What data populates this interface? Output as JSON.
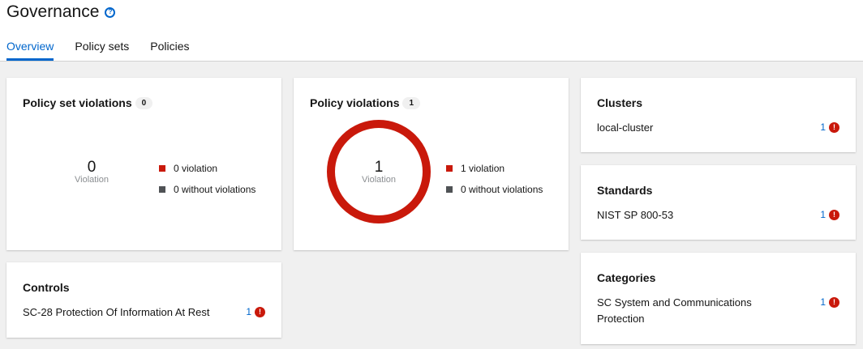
{
  "header": {
    "title": "Governance",
    "help_icon": "question-circle-icon",
    "tabs": [
      {
        "label": "Overview",
        "active": true
      },
      {
        "label": "Policy sets",
        "active": false
      },
      {
        "label": "Policies",
        "active": false
      }
    ]
  },
  "colors": {
    "violation": "#c9190b",
    "no_violation": "#4f5255",
    "link": "#0066cc"
  },
  "policy_set_violations": {
    "title": "Policy set violations",
    "badge": "0",
    "center_value": "0",
    "center_label": "Violation",
    "legend": [
      {
        "label": "0 violation",
        "color": "#c9190b"
      },
      {
        "label": "0 without violations",
        "color": "#4f5255"
      }
    ],
    "violation_fraction": 0
  },
  "policy_violations": {
    "title": "Policy violations",
    "badge": "1",
    "center_value": "1",
    "center_label": "Violation",
    "legend": [
      {
        "label": "1 violation",
        "color": "#c9190b"
      },
      {
        "label": "0 without violations",
        "color": "#4f5255"
      }
    ],
    "violation_fraction": 1
  },
  "clusters": {
    "title": "Clusters",
    "items": [
      {
        "label": "local-cluster",
        "count": "1",
        "icon": "exclamation-circle-icon"
      }
    ]
  },
  "standards": {
    "title": "Standards",
    "items": [
      {
        "label": "NIST SP 800-53",
        "count": "1",
        "icon": "exclamation-circle-icon"
      }
    ]
  },
  "categories": {
    "title": "Categories",
    "items": [
      {
        "label": "SC System and Communications Protection",
        "count": "1",
        "icon": "exclamation-circle-icon"
      }
    ]
  },
  "controls": {
    "title": "Controls",
    "items": [
      {
        "label": "SC-28 Protection Of Information At Rest",
        "count": "1",
        "icon": "exclamation-circle-icon"
      }
    ]
  }
}
